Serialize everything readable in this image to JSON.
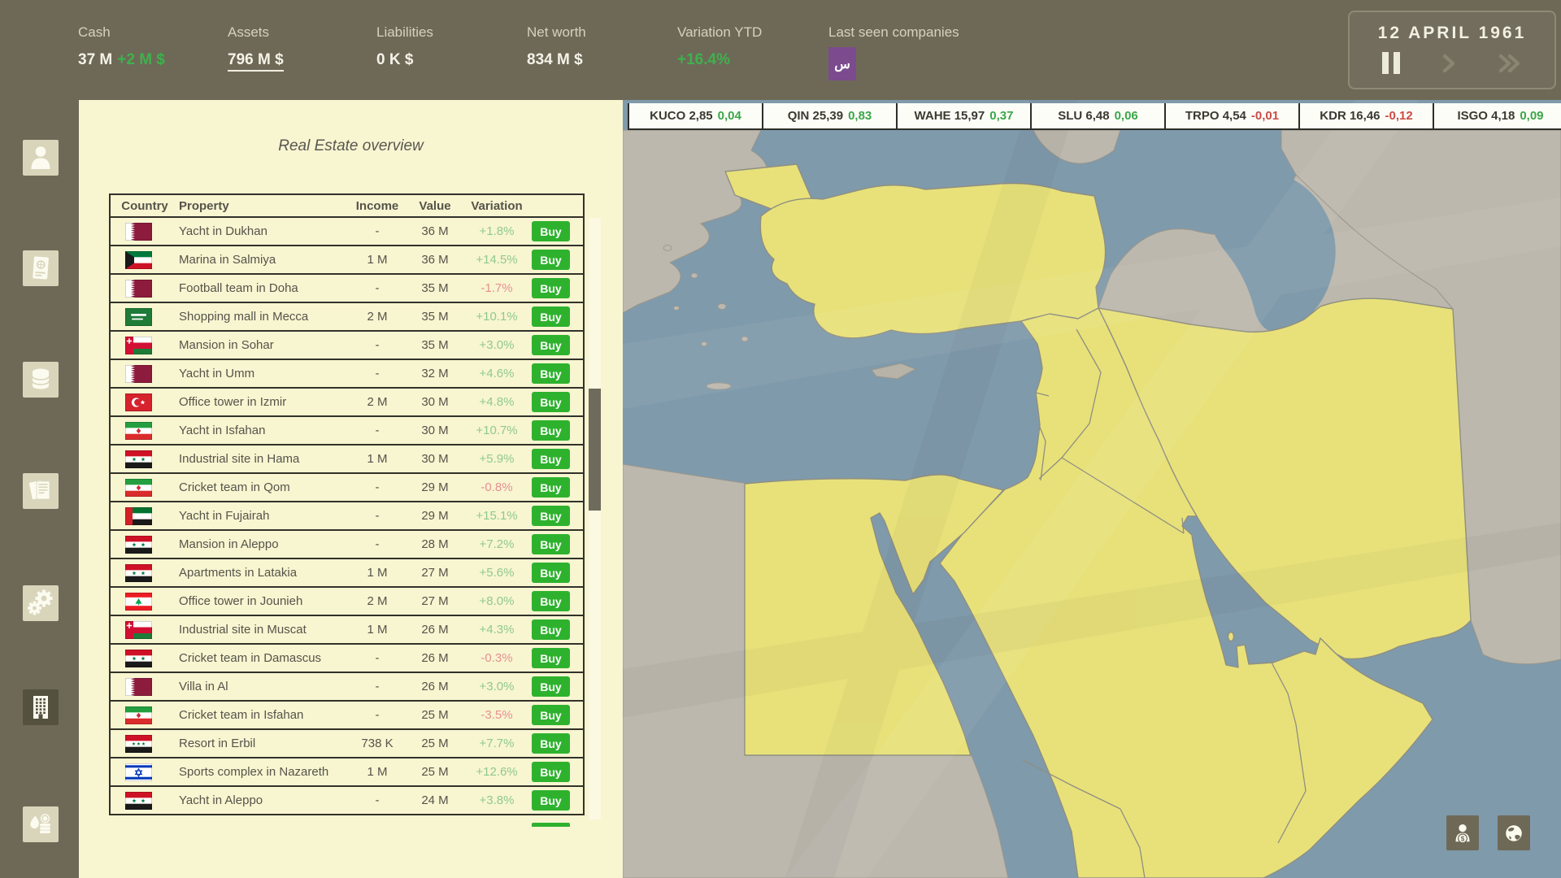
{
  "topbar": {
    "stats": [
      {
        "id": "cash",
        "label": "Cash",
        "value": "37 M",
        "delta": "+2 M $"
      },
      {
        "id": "assets",
        "label": "Assets",
        "value": "796 M $"
      },
      {
        "id": "liabilities",
        "label": "Liabilities",
        "value": "0 K $"
      },
      {
        "id": "networth",
        "label": "Net worth",
        "value": "834 M $"
      },
      {
        "id": "variation-ytd",
        "label": "Variation YTD",
        "value": "+16.4%"
      },
      {
        "id": "last-seen",
        "label": "Last seen companies",
        "badge": "س"
      }
    ],
    "date": "12 APRIL 1961"
  },
  "sidebar": {
    "items": [
      {
        "name": "profile",
        "icon": "person-icon",
        "active": false
      },
      {
        "name": "passport",
        "icon": "passport-icon",
        "active": false
      },
      {
        "name": "commodities",
        "icon": "database-icon",
        "active": false
      },
      {
        "name": "news",
        "icon": "documents-icon",
        "active": false
      },
      {
        "name": "industry",
        "icon": "gears-icon",
        "active": false
      },
      {
        "name": "real-estate",
        "icon": "building-icon",
        "active": true
      },
      {
        "name": "oil-market",
        "icon": "oil-coins-icon",
        "active": false
      }
    ]
  },
  "panel": {
    "title": "Real Estate overview",
    "columns": [
      "Country",
      "Property",
      "Income",
      "Value",
      "Variation"
    ],
    "buy_label": "Buy",
    "rows": [
      {
        "country": "qatar",
        "property": "Yacht in Dukhan",
        "income": "-",
        "value": "36 M",
        "variation": "+1.8%"
      },
      {
        "country": "kuwait",
        "property": "Marina in Salmiya",
        "income": "1 M",
        "value": "36 M",
        "variation": "+14.5%"
      },
      {
        "country": "qatar",
        "property": "Football team in Doha",
        "income": "-",
        "value": "35 M",
        "variation": "-1.7%"
      },
      {
        "country": "saudi",
        "property": "Shopping mall in Mecca",
        "income": "2 M",
        "value": "35 M",
        "variation": "+10.1%"
      },
      {
        "country": "oman",
        "property": "Mansion in Sohar",
        "income": "-",
        "value": "35 M",
        "variation": "+3.0%"
      },
      {
        "country": "qatar",
        "property": "Yacht in Umm",
        "income": "-",
        "value": "32 M",
        "variation": "+4.6%"
      },
      {
        "country": "turkey",
        "property": "Office tower in Izmir",
        "income": "2 M",
        "value": "30 M",
        "variation": "+4.8%"
      },
      {
        "country": "iran",
        "property": "Yacht in Isfahan",
        "income": "-",
        "value": "30 M",
        "variation": "+10.7%"
      },
      {
        "country": "syria",
        "property": "Industrial site in Hama",
        "income": "1 M",
        "value": "30 M",
        "variation": "+5.9%"
      },
      {
        "country": "iran",
        "property": "Cricket team in Qom",
        "income": "-",
        "value": "29 M",
        "variation": "-0.8%"
      },
      {
        "country": "uae",
        "property": "Yacht in Fujairah",
        "income": "-",
        "value": "29 M",
        "variation": "+15.1%"
      },
      {
        "country": "syria",
        "property": "Mansion in Aleppo",
        "income": "-",
        "value": "28 M",
        "variation": "+7.2%"
      },
      {
        "country": "syria",
        "property": "Apartments in Latakia",
        "income": "1 M",
        "value": "27 M",
        "variation": "+5.6%"
      },
      {
        "country": "lebanon",
        "property": "Office tower in Jounieh",
        "income": "2 M",
        "value": "27 M",
        "variation": "+8.0%"
      },
      {
        "country": "oman",
        "property": "Industrial site in Muscat",
        "income": "1 M",
        "value": "26 M",
        "variation": "+4.3%"
      },
      {
        "country": "syria",
        "property": "Cricket team in Damascus",
        "income": "-",
        "value": "26 M",
        "variation": "-0.3%"
      },
      {
        "country": "qatar",
        "property": "Villa in Al",
        "income": "-",
        "value": "26 M",
        "variation": "+3.0%"
      },
      {
        "country": "iran",
        "property": "Cricket team in Isfahan",
        "income": "-",
        "value": "25 M",
        "variation": "-3.5%"
      },
      {
        "country": "iraq",
        "property": "Resort in Erbil",
        "income": "738 K",
        "value": "25 M",
        "variation": "+7.7%"
      },
      {
        "country": "israel",
        "property": "Sports complex in Nazareth",
        "income": "1 M",
        "value": "25 M",
        "variation": "+12.6%"
      },
      {
        "country": "syria",
        "property": "Yacht in Aleppo",
        "income": "-",
        "value": "24 M",
        "variation": "+3.8%"
      }
    ]
  },
  "ticker": [
    {
      "symbol": "KUCO",
      "price": "2,85",
      "change": "0,04",
      "dir": "up"
    },
    {
      "symbol": "QIN",
      "price": "25,39",
      "change": "0,83",
      "dir": "up"
    },
    {
      "symbol": "WAHE",
      "price": "15,97",
      "change": "0,37",
      "dir": "up"
    },
    {
      "symbol": "SLU",
      "price": "6,48",
      "change": "0,06",
      "dir": "up"
    },
    {
      "symbol": "TRPO",
      "price": "4,54",
      "change": "-0,01",
      "dir": "down"
    },
    {
      "symbol": "KDR",
      "price": "16,46",
      "change": "-0,12",
      "dir": "down"
    },
    {
      "symbol": "ISGO",
      "price": "4,18",
      "change": "0,09",
      "dir": "up"
    }
  ],
  "colors": {
    "topbar_bg": "#6e6957",
    "panel_bg": "#f8f5d1",
    "buy_green": "#2eb22e",
    "positive_green": "#8fc98f",
    "negative_red": "#e59090",
    "topbar_green": "#3db24d",
    "ticker_up": "#3aa648",
    "ticker_down": "#cc4b44",
    "badge_purple": "#7b4b8e",
    "map_land_yellow": "#e8e17a",
    "map_sea_blue": "#7f9aab",
    "map_land_gray": "#bcb8ad"
  }
}
